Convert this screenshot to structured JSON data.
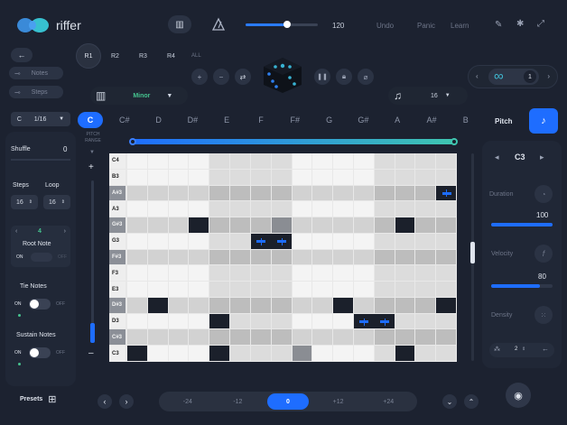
{
  "app": {
    "name": "riffer"
  },
  "header": {
    "tempo": "120",
    "undo": "Undo",
    "panic": "Panic",
    "learn": "Learn",
    "tempo_fill": 0.58
  },
  "riffs": [
    "R1",
    "R2",
    "R3",
    "R4",
    "ALL"
  ],
  "toolbar": {
    "notes_label": "Notes",
    "steps_label": "Steps",
    "scale": "Minor",
    "rhythm_value": "16",
    "loop_count": "1"
  },
  "root_select": {
    "root": "C",
    "division": "1/16"
  },
  "note_tabs": [
    "C",
    "C#",
    "D",
    "D#",
    "E",
    "F",
    "F#",
    "G",
    "G#",
    "A",
    "A#",
    "B"
  ],
  "pitch_label": "Pitch",
  "pitch_range_label": "PITCH RANGE",
  "pitch_range_plus": "+",
  "pitch_range_minus": "–",
  "left_panel": {
    "shuffle_label": "Shuffle",
    "shuffle_value": "0",
    "steps_label": "Steps",
    "loop_label": "Loop",
    "steps_value": "16",
    "loop_value": "16",
    "root_note_value": "4",
    "root_note_label": "Root Note",
    "root_on": "ON",
    "root_off": "OFF",
    "tie_notes_label": "Tie Notes",
    "tie_on": "ON",
    "tie_off": "OFF",
    "sustain_notes_label": "Sustain Notes",
    "sustain_on": "ON",
    "sustain_off": "OFF"
  },
  "piano_keys": [
    "C4",
    "B3",
    "A#3",
    "A3",
    "G#3",
    "G3",
    "F#3",
    "F3",
    "E3",
    "D#3",
    "D3",
    "C#3",
    "C3"
  ],
  "right_panel": {
    "note": "C3",
    "duration_label": "Duration",
    "duration_value": "100",
    "duration_fill": 1.0,
    "velocity_label": "Velocity",
    "velocity_value": "80",
    "velocity_fill": 0.8,
    "density_label": "Density",
    "octave_value": "2"
  },
  "footer": {
    "presets_label": "Presets",
    "transpose": [
      "-24",
      "-12",
      "0",
      "+12",
      "+24"
    ],
    "transpose_selected": "0"
  },
  "colors": {
    "accent": "#1e6dff",
    "bg": "#1c2230",
    "panel": "#232a39",
    "cyan": "#3fb8d0"
  }
}
